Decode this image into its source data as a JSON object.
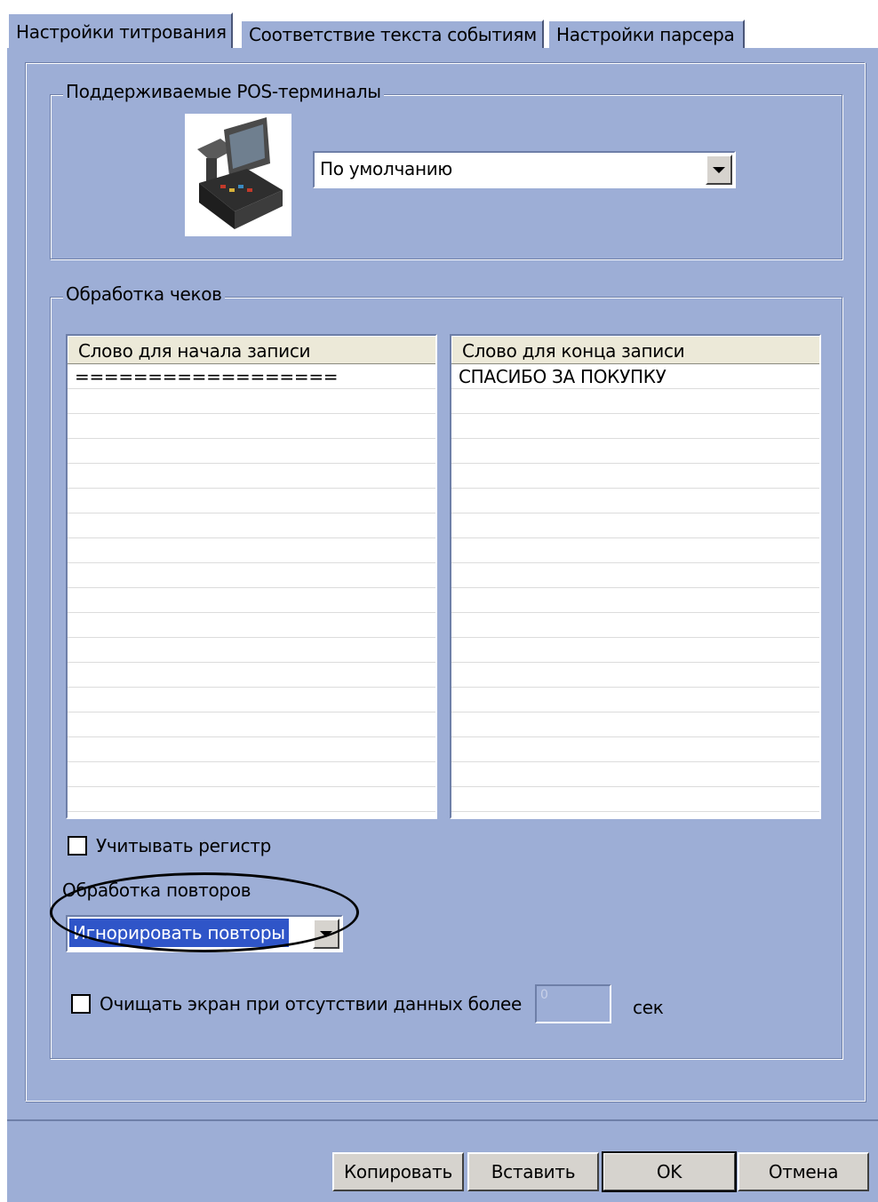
{
  "tabs": [
    {
      "label": "Настройки титрования",
      "active": true
    },
    {
      "label": "Соответствие текста событиям",
      "active": false
    },
    {
      "label": "Настройки парсера",
      "active": false
    }
  ],
  "pos_group": {
    "title": "Поддерживаемые POS-терминалы",
    "terminal_icon": "pos-terminal-image",
    "terminal_combo_value": "По умолчанию"
  },
  "receipts_group": {
    "title": "Обработка чеков",
    "start_list": {
      "header": "Слово для начала записи",
      "rows": [
        "==================",
        "",
        "",
        "",
        "",
        "",
        "",
        "",
        "",
        "",
        "",
        "",
        "",
        "",
        "",
        "",
        "",
        ""
      ]
    },
    "end_list": {
      "header": "Слово для конца записи",
      "rows": [
        "СПАСИБО ЗА ПОКУПКУ",
        "",
        "",
        "",
        "",
        "",
        "",
        "",
        "",
        "",
        "",
        "",
        "",
        "",
        "",
        "",
        "",
        ""
      ]
    },
    "case_checkbox_label": "Учитывать регистр",
    "case_checked": false,
    "repeat_label": "Обработка повторов",
    "repeat_combo_value": "Игнорировать повторы",
    "clear_checkbox_label": "Очищать экран при отсутствии данных более",
    "clear_checked": false,
    "clear_value": "0",
    "clear_unit": "сек"
  },
  "buttons": {
    "copy": "Копировать",
    "paste": "Вставить",
    "ok": "OK",
    "cancel": "Отмена"
  },
  "colors": {
    "panel": "#9daed6",
    "selection": "#2f55c8"
  }
}
